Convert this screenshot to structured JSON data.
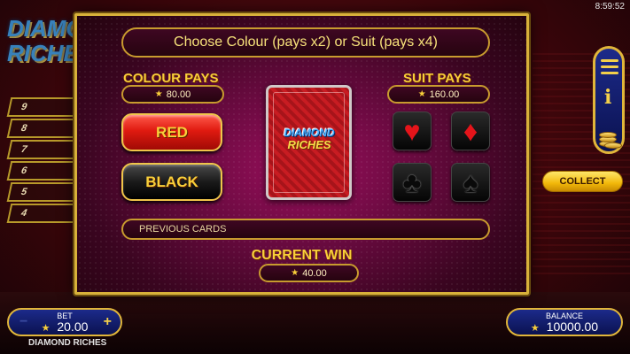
{
  "status_bar": {
    "time": "8:59:52"
  },
  "background": {
    "logo_text_1": "DIAMOND",
    "logo_text_2": "RICHES",
    "ladder_levels": [
      "9",
      "8",
      "7",
      "6",
      "5",
      "4"
    ]
  },
  "gamble": {
    "title": "Choose Colour (pays x2) or Suit (pays x4)",
    "colour_pays_label": "COLOUR PAYS",
    "colour_pays_value": "80.00",
    "suit_pays_label": "SUIT PAYS",
    "suit_pays_value": "160.00",
    "red_label": "RED",
    "black_label": "BLACK",
    "card_logo_1": "DIAMOND",
    "card_logo_2": "RICHES",
    "suits": {
      "heart": "♥",
      "diamond": "♦",
      "club": "♣",
      "spade": "♠"
    },
    "previous_cards_label": "PREVIOUS CARDS",
    "current_win_label": "CURRENT WIN",
    "current_win_value": "40.00"
  },
  "side": {
    "collect_label": "COLLECT"
  },
  "footer": {
    "bet_label": "BET",
    "bet_value": "20.00",
    "bet_minus": "−",
    "bet_plus": "+",
    "balance_label": "BALANCE",
    "balance_value": "10000.00",
    "game_name": "DIAMOND RICHES"
  },
  "colors": {
    "gold": "#f8ce3a",
    "red_button": "#e01a10",
    "black_button": "#1a1a1a",
    "panel_blue": "#1c2a8a",
    "modal_magenta": "#9a0f5c"
  }
}
